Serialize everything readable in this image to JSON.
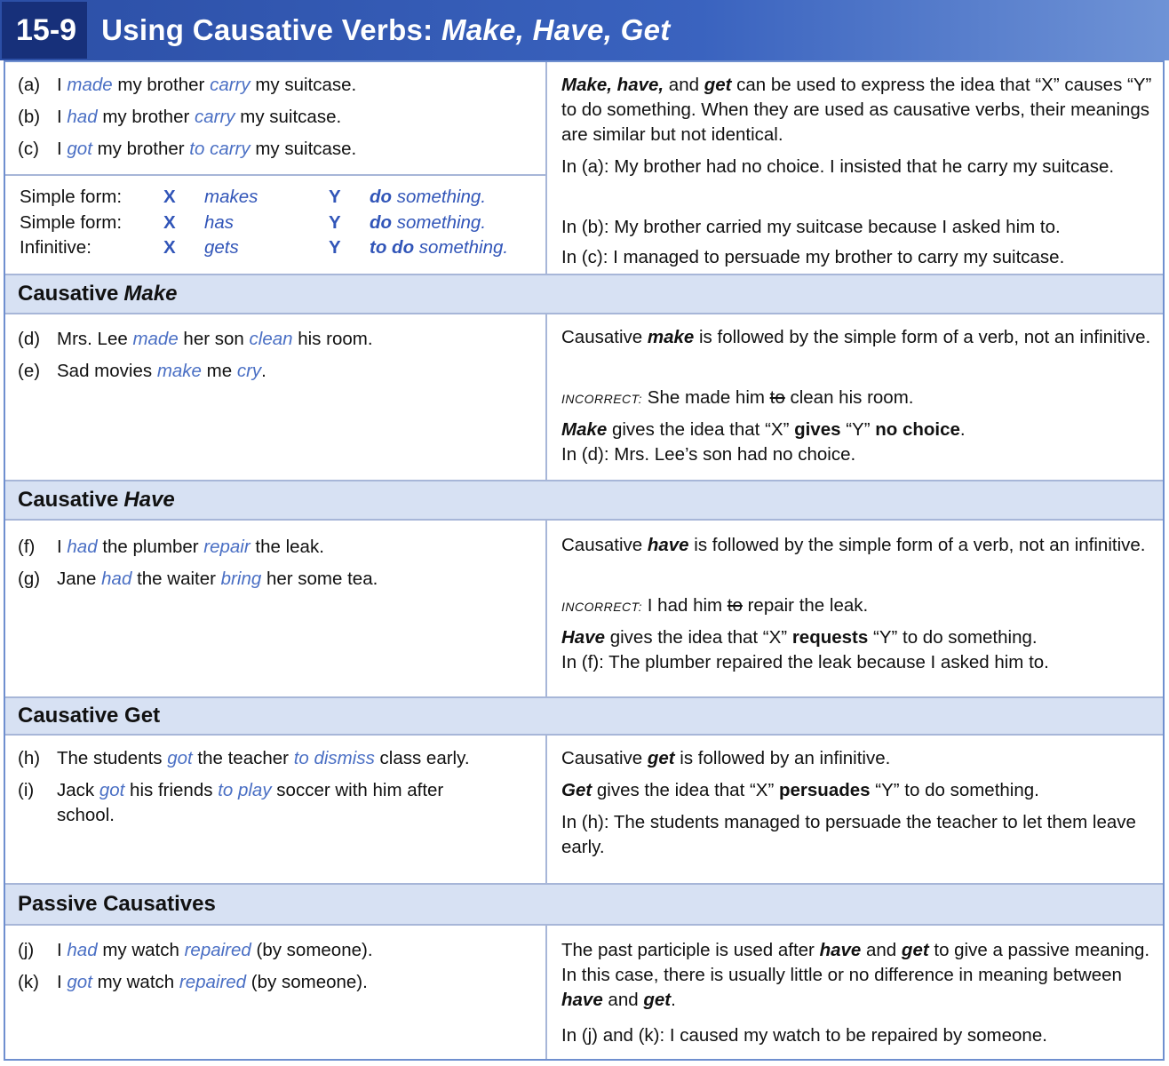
{
  "title": {
    "number": "15-9",
    "text": "Using Causative Verbs: ",
    "verbs": "Make, Have, Get"
  },
  "intro": {
    "examples": [
      {
        "label": "(a)",
        "pre": "I ",
        "v1": "made",
        "mid": " my brother ",
        "v2": "carry",
        "post": " my suitcase."
      },
      {
        "label": "(b)",
        "pre": "I ",
        "v1": "had",
        "mid": " my brother ",
        "v2": "carry",
        "post": " my suitcase."
      },
      {
        "label": "(c)",
        "pre": "I ",
        "v1": "got",
        "mid": " my brother ",
        "v2": "to carry",
        "post": " my suitcase."
      }
    ],
    "forms": [
      {
        "name": "Simple form:",
        "x": "X",
        "verb": "makes",
        "y": "Y",
        "rest_a": "do",
        "rest_b": " something."
      },
      {
        "name": "Simple form:",
        "x": "X",
        "verb": "has",
        "y": "Y",
        "rest_a": "do",
        "rest_b": " something."
      },
      {
        "name": "Infinitive:",
        "x": "X",
        "verb": "gets",
        "y": "Y",
        "rest_a": "to do",
        "rest_b": " something."
      }
    ],
    "exp1_a": "Make, have,",
    "exp1_b": " and ",
    "exp1_c": "get",
    "exp1_d": " can be used to express the idea that “X” causes “Y” to do something.  When they are used as causative verbs, their meanings are similar but not identical.",
    "exp2": "In (a):  My brother had no choice.  I insisted that he carry my suitcase.",
    "exp3": "In (b):  My brother carried my suitcase because I asked him to.",
    "exp4": "In (c):  I managed to persuade my brother to carry my suitcase."
  },
  "make": {
    "head": "Causative",
    "head_kw": "Make",
    "examples": [
      {
        "label": "(d)",
        "pre": "Mrs. Lee ",
        "v1": "made",
        "mid": " her son ",
        "v2": "clean",
        "post": " his room."
      },
      {
        "label": "(e)",
        "pre": "Sad movies ",
        "v1": "make",
        "mid": " me ",
        "v2": "cry",
        "post": "."
      }
    ],
    "exp1_a": "Causative ",
    "exp1_b": "make",
    "exp1_c": " is followed by the simple form of a verb, not an infinitive.",
    "inc_label": "INCORRECT:",
    "inc_a": " She made him ",
    "inc_strike": "to",
    "inc_b": " clean his room.",
    "exp3_a": "Make",
    "exp3_b": " gives the idea that “X” ",
    "exp3_c": "gives",
    "exp3_d": " “Y” ",
    "exp3_e": "no choice",
    "exp3_f": ".",
    "exp4": "In (d):  Mrs. Lee’s son had no choice."
  },
  "have": {
    "head": "Causative",
    "head_kw": "Have",
    "examples": [
      {
        "label": "(f)",
        "pre": "I ",
        "v1": "had",
        "mid": " the plumber ",
        "v2": "repair",
        "post": " the leak."
      },
      {
        "label": "(g)",
        "pre": "Jane ",
        "v1": "had",
        "mid": " the waiter ",
        "v2": "bring",
        "post": " her some tea."
      }
    ],
    "exp1_a": "Causative ",
    "exp1_b": "have",
    "exp1_c": " is followed by the simple form of a verb, not an infinitive.",
    "inc_label": "INCORRECT:",
    "inc_a": " I had him ",
    "inc_strike": "to",
    "inc_b": " repair the leak.",
    "exp3_a": "Have",
    "exp3_b": " gives the idea that “X” ",
    "exp3_c": "requests",
    "exp3_d": " “Y” to do something.",
    "exp4": "In (f):  The plumber repaired the leak because I asked him to."
  },
  "get": {
    "head": "Causative Get",
    "examples": [
      {
        "label": "(h)",
        "pre": "The students ",
        "v1": "got",
        "mid": " the teacher ",
        "v2": "to dismiss",
        "post": " class early."
      },
      {
        "label": "(i)",
        "pre": "Jack ",
        "v1": "got",
        "mid": " his friends ",
        "v2": "to play",
        "post": " soccer with him after"
      }
    ],
    "ex_i_line2": "school.",
    "exp1_a": "Causative ",
    "exp1_b": "get",
    "exp1_c": " is followed by an infinitive.",
    "exp2_a": "Get",
    "exp2_b": " gives the idea that “X” ",
    "exp2_c": "persuades",
    "exp2_d": " “Y” to do something.",
    "exp3": "In (h):  The students managed to persuade the teacher to let them leave early."
  },
  "passive": {
    "head": "Passive Causatives",
    "examples": [
      {
        "label": "(j)",
        "pre": "I ",
        "v1": "had",
        "mid": " my watch ",
        "v2": "repaired",
        "post": " (by someone)."
      },
      {
        "label": "(k)",
        "pre": "I ",
        "v1": "got",
        "mid": " my watch ",
        "v2": "repaired",
        "post": " (by someone)."
      }
    ],
    "exp1_a": "The past participle is used after ",
    "exp1_b": "have",
    "exp1_c": " and ",
    "exp1_d": "get",
    "exp1_e": " to give a passive meaning.  In this case, there is usually little or no difference in meaning between ",
    "exp1_f": "have",
    "exp1_g": " and ",
    "exp1_h": "get",
    "exp1_i": ".",
    "exp2": "In (j) and (k):  I caused my watch to be repaired by someone."
  },
  "colors": {
    "title_bg": "#3a63bf",
    "badge_bg": "#17307a",
    "verb_blue": "#4a6fc4",
    "section_bg": "#d7e1f3",
    "rule": "#a7b6d8"
  }
}
